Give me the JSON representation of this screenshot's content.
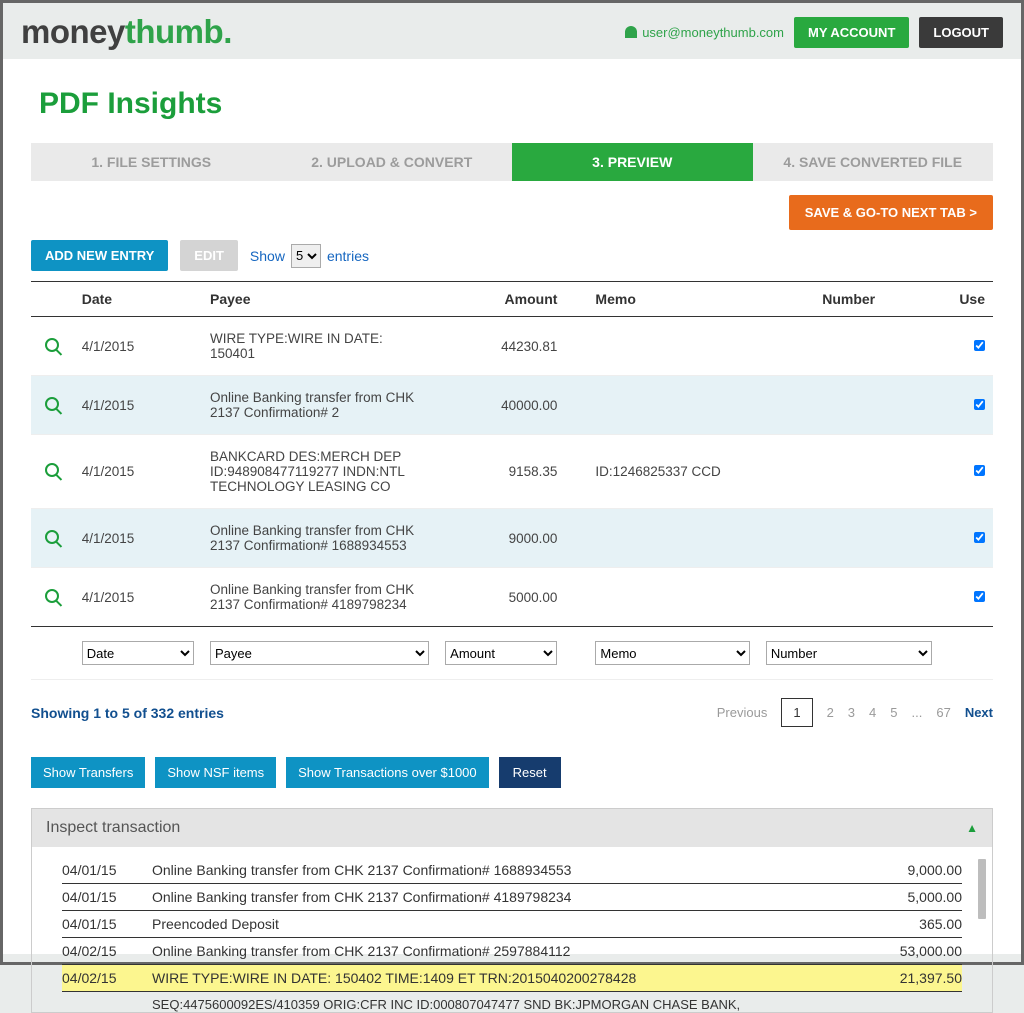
{
  "header": {
    "logo_part1": "money",
    "logo_part2": "thumb",
    "logo_tm": "®",
    "user_email": "user@moneythumb.com",
    "btn_account": "MY ACCOUNT",
    "btn_logout": "LOGOUT"
  },
  "page_title": "PDF Insights",
  "tabs": [
    "1. FILE SETTINGS",
    "2. UPLOAD & CONVERT",
    "3. PREVIEW",
    "4. SAVE CONVERTED FILE"
  ],
  "active_tab_index": 2,
  "save_next_btn": "SAVE & GO-TO NEXT TAB >",
  "add_entry_btn": "ADD NEW ENTRY",
  "edit_btn": "EDIT",
  "show_label": "Show",
  "entries_label": "entries",
  "entries_value": "5",
  "columns": {
    "date": "Date",
    "payee": "Payee",
    "amount": "Amount",
    "memo": "Memo",
    "number": "Number",
    "use": "Use"
  },
  "rows": [
    {
      "date": "4/1/2015",
      "payee": "WIRE TYPE:WIRE IN DATE: 150401",
      "amount": "44230.81",
      "memo": "",
      "use": true
    },
    {
      "date": "4/1/2015",
      "payee": "Online Banking transfer from CHK 2137 Confirmation# 2",
      "amount": "40000.00",
      "memo": "",
      "use": true
    },
    {
      "date": "4/1/2015",
      "payee": "BANKCARD DES:MERCH DEP ID:948908477119277 INDN:NTL TECHNOLOGY LEASING CO",
      "amount": "9158.35",
      "memo": "ID:1246825337 CCD",
      "use": true
    },
    {
      "date": "4/1/2015",
      "payee": "Online Banking transfer from CHK 2137 Confirmation# 1688934553",
      "amount": "9000.00",
      "memo": "",
      "use": true
    },
    {
      "date": "4/1/2015",
      "payee": "Online Banking transfer from CHK 2137 Confirmation# 4189798234",
      "amount": "5000.00",
      "memo": "",
      "use": true
    }
  ],
  "filters": {
    "date": "Date",
    "payee": "Payee",
    "amount": "Amount",
    "memo": "Memo",
    "number": "Number"
  },
  "paging": {
    "info": "Showing 1 to 5 of 332 entries",
    "prev": "Previous",
    "next": "Next",
    "pages": [
      "1",
      "2",
      "3",
      "4",
      "5",
      "...",
      "67"
    ]
  },
  "filter_buttons": {
    "transfers": "Show Transfers",
    "nsf": "Show NSF items",
    "over1000": "Show Transactions over $1000",
    "reset": "Reset"
  },
  "inspect": {
    "title": "Inspect transaction",
    "rows": [
      {
        "date": "04/01/15",
        "desc": "Online Banking transfer from CHK 2137 Confirmation# 1688934553",
        "amount": "9,000.00",
        "hl": false
      },
      {
        "date": "04/01/15",
        "desc": "Online Banking transfer from CHK 2137 Confirmation# 4189798234",
        "amount": "5,000.00",
        "hl": false
      },
      {
        "date": "04/01/15",
        "desc": "Preencoded Deposit",
        "amount": "365.00",
        "hl": false
      },
      {
        "date": "04/02/15",
        "desc": "Online Banking transfer from CHK 2137 Confirmation# 2597884112",
        "amount": "53,000.00",
        "hl": false
      },
      {
        "date": "04/02/15",
        "desc": "WIRE TYPE:WIRE IN DATE: 150402 TIME:1409 ET TRN:2015040200278428",
        "amount": "21,397.50",
        "hl": true
      }
    ],
    "continuation": "SEQ:4475600092ES/410359 ORIG:CFR INC ID:000807047477 SND BK:JPMORGAN CHASE  BANK,"
  }
}
